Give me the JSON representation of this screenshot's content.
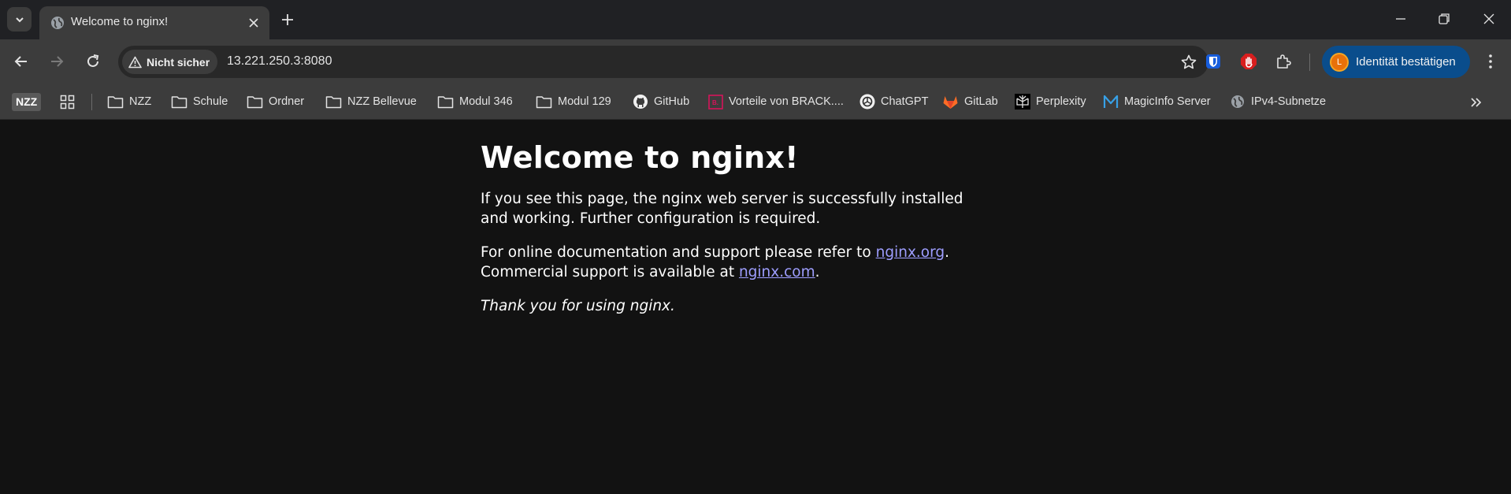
{
  "browser": {
    "tab": {
      "title": "Welcome to nginx!"
    },
    "address_bar": {
      "security_label": "Nicht sicher",
      "url": "13.221.250.3:8080"
    },
    "identity_button": {
      "label": "Identität bestätigen",
      "avatar_letter": "L"
    },
    "bookmarks": {
      "nzz_badge": "NZZ",
      "items": [
        {
          "label": "NZZ",
          "icon": "folder-icon"
        },
        {
          "label": "Schule",
          "icon": "folder-icon"
        },
        {
          "label": "Ordner",
          "icon": "folder-icon"
        },
        {
          "label": "NZZ Bellevue",
          "icon": "folder-icon"
        },
        {
          "label": "Modul 346",
          "icon": "folder-icon"
        },
        {
          "label": "Modul 129",
          "icon": "folder-icon"
        },
        {
          "label": "GitHub",
          "icon": "github-icon"
        },
        {
          "label": "Vorteile von BRACK....",
          "icon": "brack-icon"
        },
        {
          "label": "ChatGPT",
          "icon": "chatgpt-icon"
        },
        {
          "label": "GitLab",
          "icon": "gitlab-icon"
        },
        {
          "label": "Perplexity",
          "icon": "perplexity-icon"
        },
        {
          "label": "MagicInfo Server",
          "icon": "magicinfo-icon"
        },
        {
          "label": "IPv4-Subnetze",
          "icon": "globe-icon"
        }
      ]
    },
    "colors": {
      "identity_button": "#0a4d8c",
      "link": "#9e9eff",
      "page_bg": "#121212"
    }
  },
  "content": {
    "heading": "Welcome to nginx!",
    "p1": "If you see this page, the nginx web server is successfully installed and working. Further configuration is required.",
    "p2_before": "For online documentation and support please refer to ",
    "p2_link1": "nginx.org",
    "p2_middle": ".",
    "p2_line2_before": "Commercial support is available at ",
    "p2_link2": "nginx.com",
    "p2_end": ".",
    "p3": "Thank you for using nginx."
  }
}
